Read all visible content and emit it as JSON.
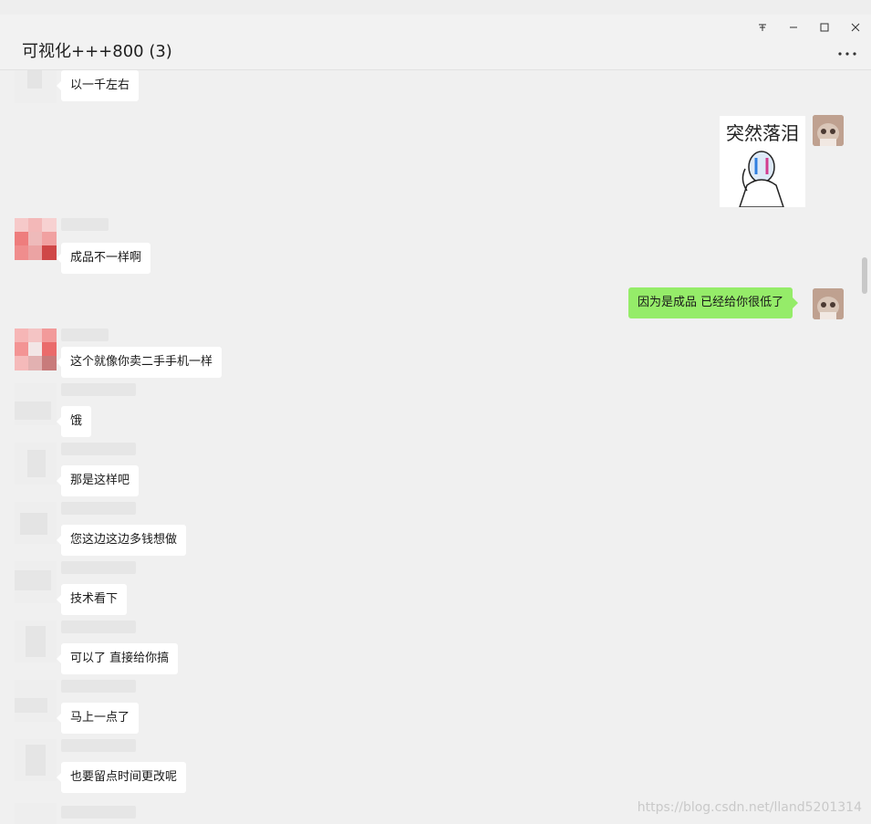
{
  "window": {
    "title": "可视化+++800 (3)",
    "controls": [
      "pin-icon",
      "minimize-icon",
      "maximize-icon",
      "close-icon"
    ],
    "more_icon": "more-dots-icon"
  },
  "messages": [
    {
      "side": "left",
      "type": "text",
      "text": "以一千左右"
    },
    {
      "side": "right",
      "type": "sticker",
      "text": "突然落泪"
    },
    {
      "side": "left",
      "type": "text",
      "text": "成品不一样啊"
    },
    {
      "side": "right",
      "type": "text",
      "text": "因为是成品 已经给你很低了"
    },
    {
      "side": "left",
      "type": "text",
      "text": "这个就像你卖二手手机一样"
    },
    {
      "side": "left",
      "type": "text",
      "text": "饿"
    },
    {
      "side": "left",
      "type": "text",
      "text": "那是这样吧"
    },
    {
      "side": "left",
      "type": "text",
      "text": "您这边这边多钱想做"
    },
    {
      "side": "left",
      "type": "text",
      "text": "技术看下"
    },
    {
      "side": "left",
      "type": "text",
      "text": "可以了 直接给你搞"
    },
    {
      "side": "left",
      "type": "text",
      "text": "马上一点了"
    },
    {
      "side": "left",
      "type": "text",
      "text": "也要留点时间更改呢"
    }
  ],
  "watermark": "https://blog.csdn.net/lland5201314",
  "colors": {
    "self_bubble": "#95ec69",
    "other_bubble": "#ffffff",
    "background": "#f0f0f0"
  }
}
